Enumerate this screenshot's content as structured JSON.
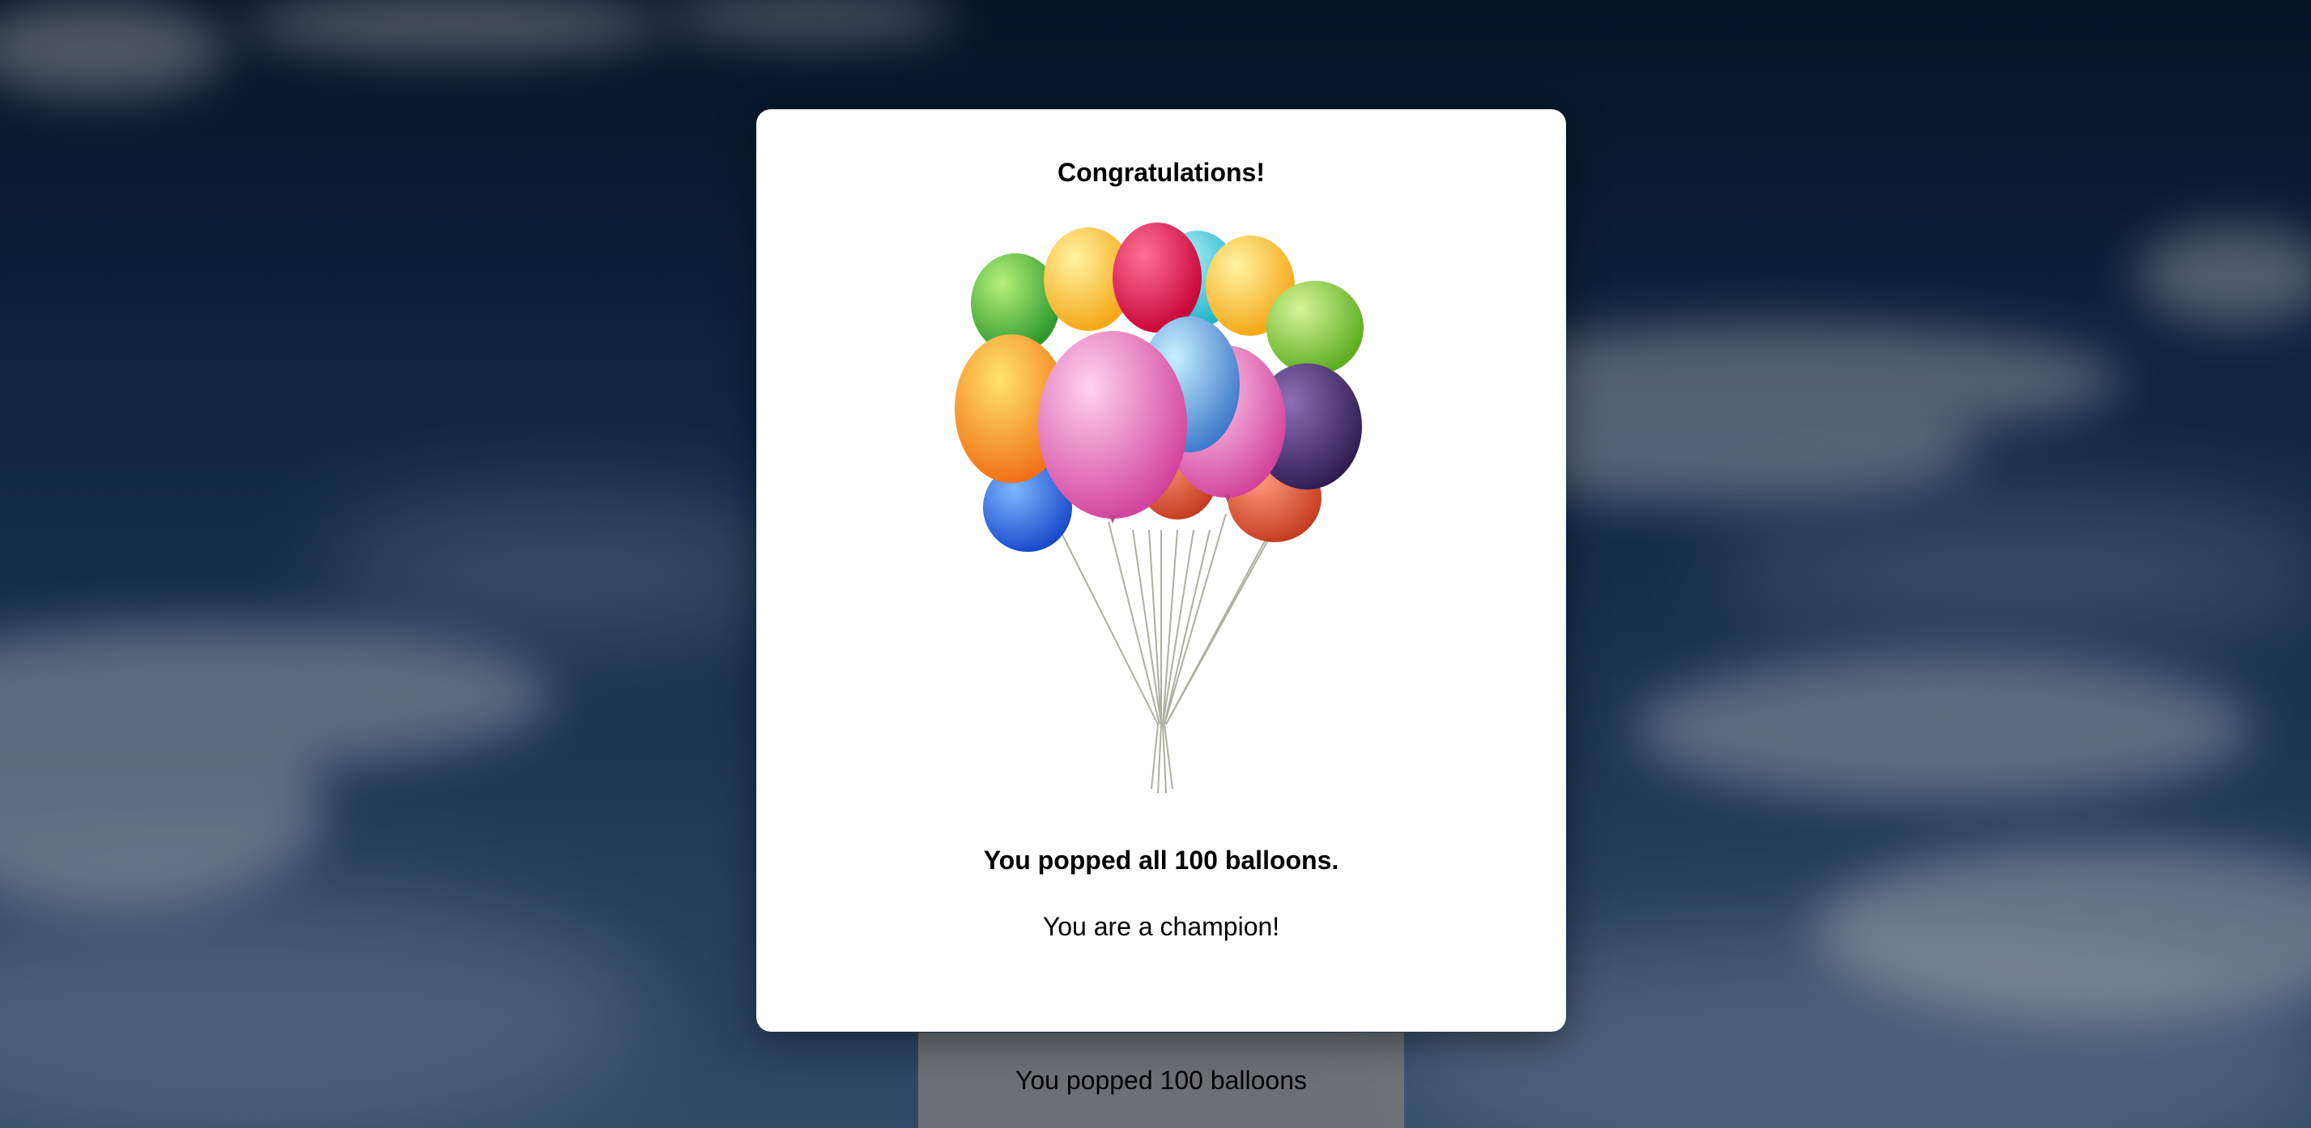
{
  "modal": {
    "title": "Congratulations!",
    "popped_message": "You popped all 100 balloons.",
    "champion_message": "You are a champion!"
  },
  "status_bar": {
    "text": "You popped 100 balloons"
  },
  "colors": {
    "sky_dark": "#0b2340",
    "sky_light": "#2f4f78",
    "modal_bg": "#ffffff",
    "status_bg": "#7a7a7a"
  },
  "illustration": {
    "name": "balloon-bunch",
    "balloon_colors": [
      "#3dbb3d",
      "#ffcc33",
      "#e8154d",
      "#39c7d9",
      "#ffc233",
      "#7cc73a",
      "#ff8a1a",
      "#e75bb4",
      "#5aa7e8",
      "#ee6fbd",
      "#4a2c6e",
      "#2e6fe8",
      "#e55233",
      "#d8482e"
    ]
  }
}
